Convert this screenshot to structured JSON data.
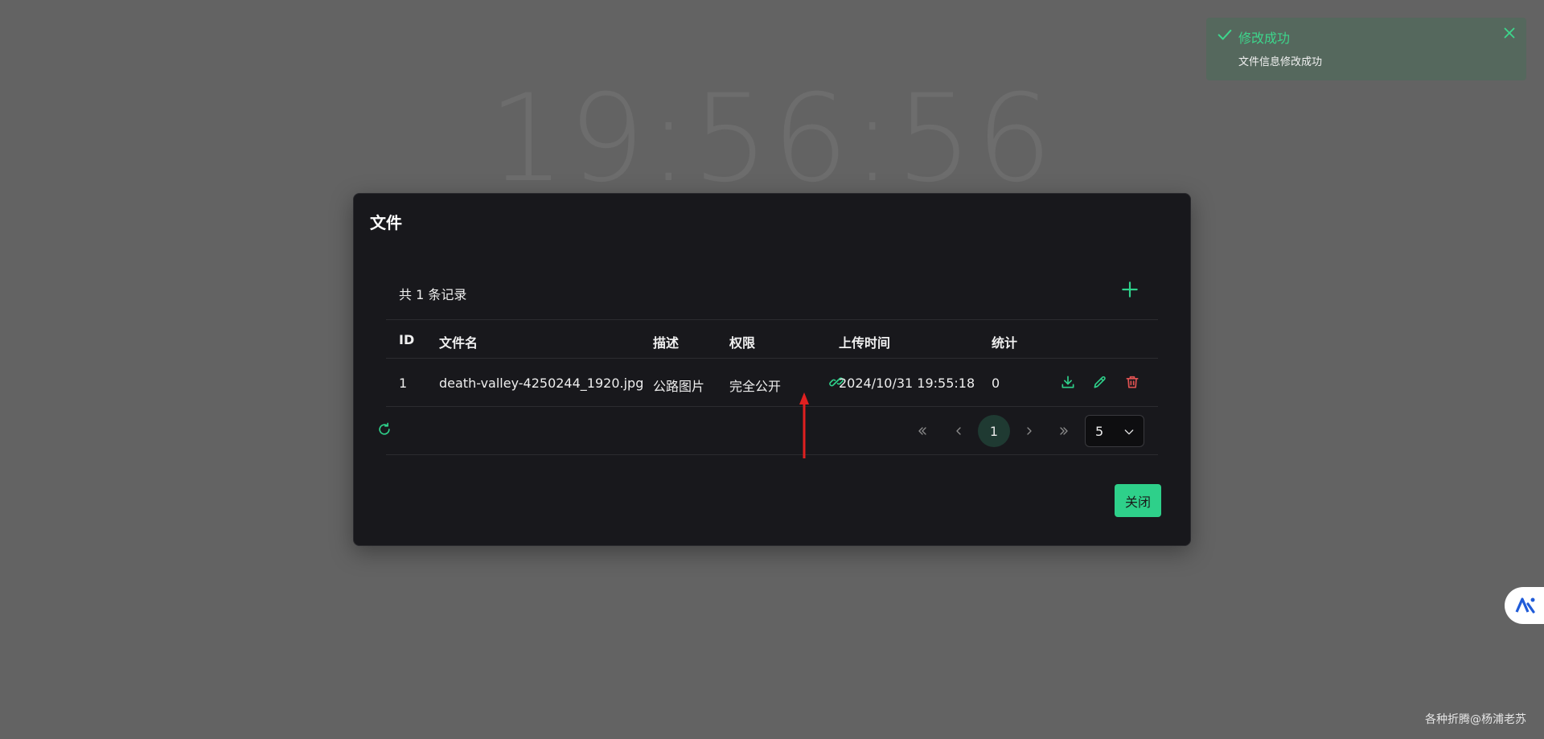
{
  "background": {
    "clock": "19:56:56"
  },
  "toast": {
    "title": "修改成功",
    "body": "文件信息修改成功",
    "color": "#3dd68c",
    "icons": {
      "status": "check-icon",
      "close": "close-icon"
    }
  },
  "modal": {
    "title": "文件",
    "record_count": "共 1 条记录",
    "add_icon": "plus-icon",
    "table": {
      "headers": {
        "id": "ID",
        "name": "文件名",
        "desc": "描述",
        "perm": "权限",
        "time": "上传时间",
        "stats": "统计"
      },
      "rows": [
        {
          "id": "1",
          "name": "death-valley-4250244_1920.jpg",
          "desc": "公路图片",
          "perm": "完全公开",
          "perm_icon": "link-icon",
          "time": "2024/10/31 19:55:18",
          "stats": "0",
          "actions": [
            "download-icon",
            "edit-icon",
            "delete-icon"
          ]
        }
      ]
    },
    "pagination": {
      "current_page": "1",
      "page_size": "5",
      "icons": [
        "first-page-icon",
        "prev-page-icon",
        "next-page-icon",
        "last-page-icon"
      ]
    },
    "close_label": "关闭",
    "accent": "#2ed08a",
    "danger": "#e05252"
  },
  "watermark": "各种折腾@杨浦老苏",
  "side_badge_icon": "ai-badge-icon"
}
